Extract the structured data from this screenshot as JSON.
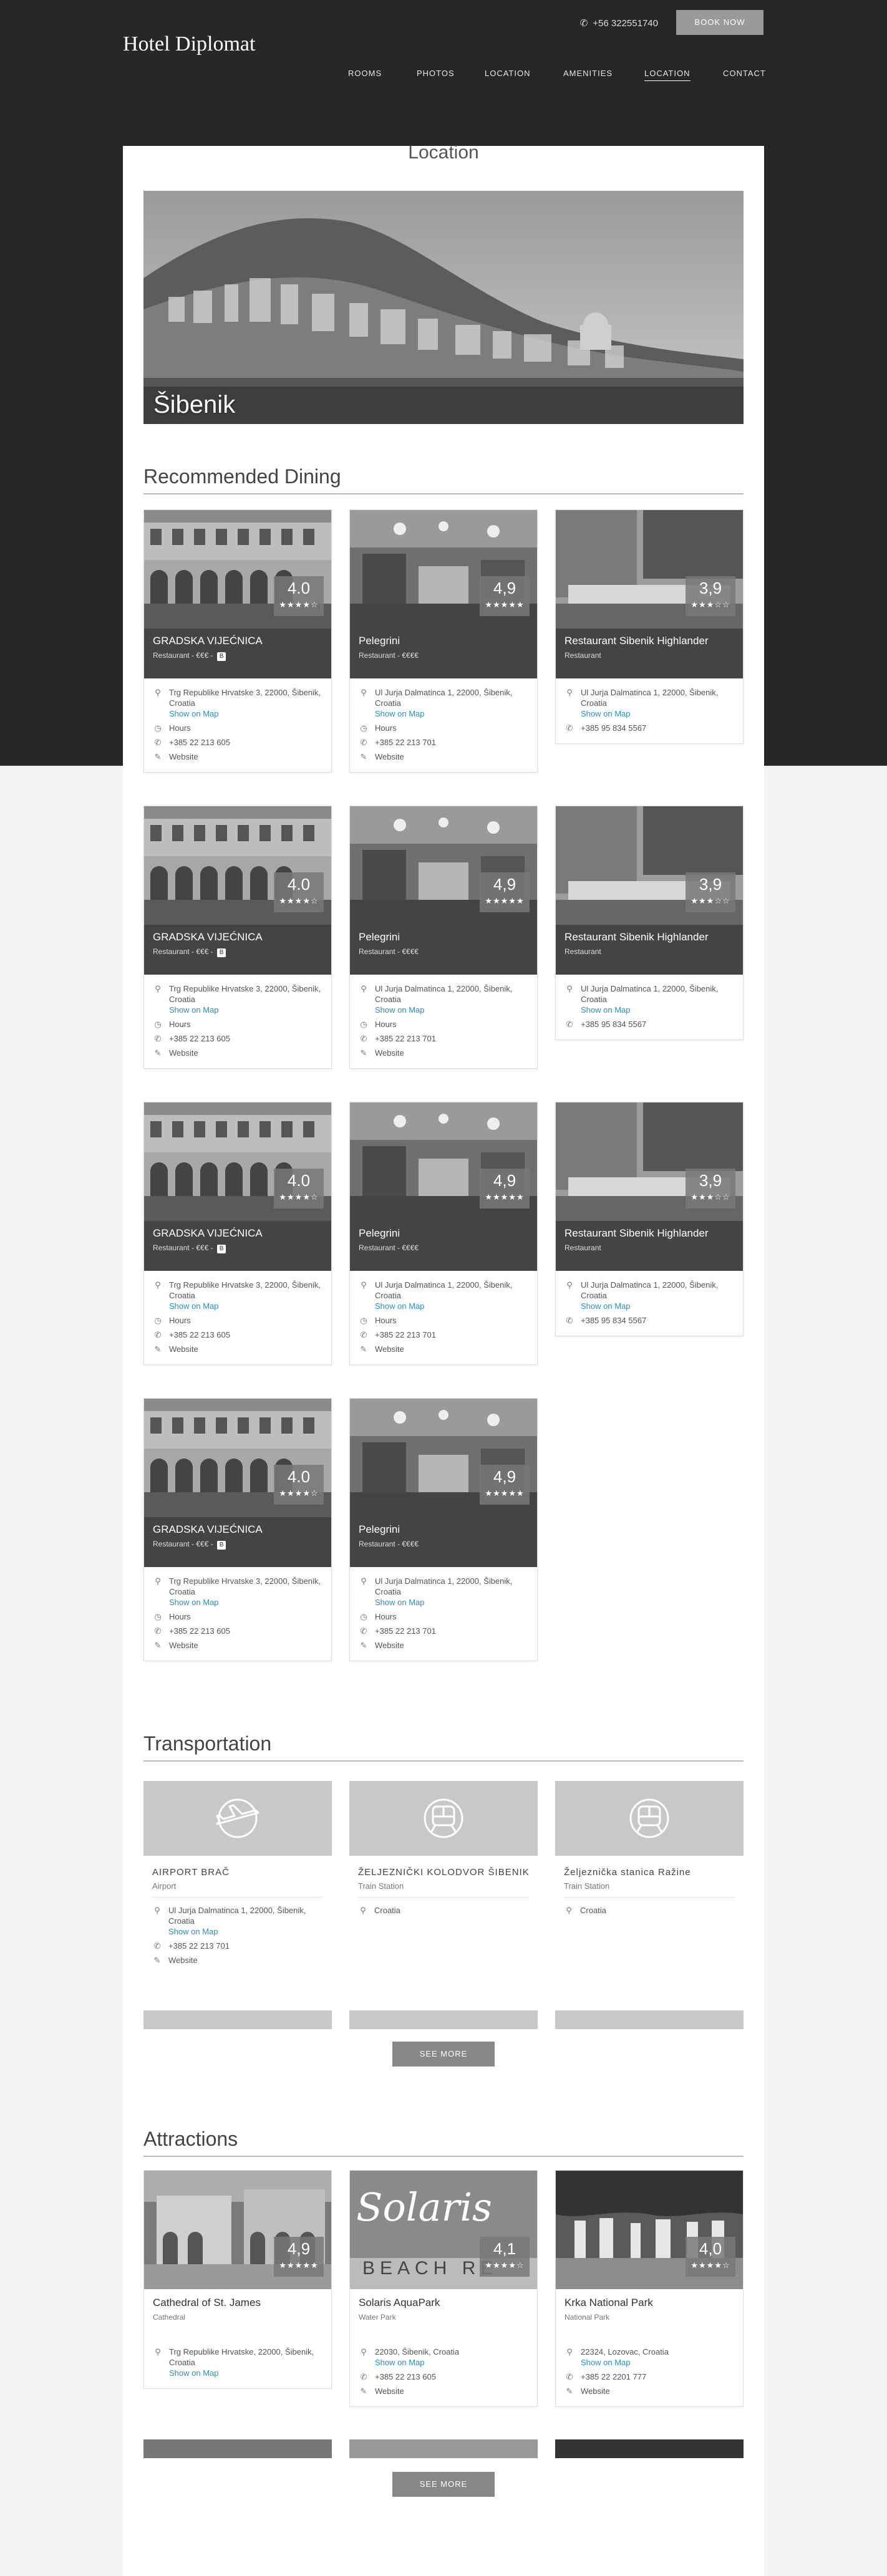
{
  "header": {
    "brand": "Hotel Diplomat",
    "phone": "+56 322551740",
    "book_label": "BOOK NOW",
    "nav": [
      "ROOMS",
      "PHOTOS",
      "LOCATION",
      "AMENITIES",
      "LOCATION",
      "CONTACT"
    ],
    "active_nav": "LOCATION"
  },
  "location": {
    "title": "Location",
    "hero_caption": "Šibenik"
  },
  "dining": {
    "title": "Recommended Dining",
    "cards": [
      {
        "name": "GRADSKA VIJEĆNICA",
        "type": "Restaurant - €€€ -",
        "badge": "B",
        "rating": "4.0",
        "stars": "★★★★☆",
        "address": "Trg Republike Hrvatske 3, 22000, Šibenik, Croatia",
        "show_map": "Show on Map",
        "hours": "Hours",
        "phone": "+385 22 213 605",
        "website": "Website"
      },
      {
        "name": "Pelegrini",
        "type": "Restaurant - €€€€",
        "badge": "",
        "rating": "4,9",
        "stars": "★★★★★",
        "address": "Ul Jurja Dalmatinca 1, 22000, Šibenik, Croatia",
        "show_map": "Show on Map",
        "hours": "Hours",
        "phone": "+385 22 213 701",
        "website": "Website"
      },
      {
        "name": "Restaurant Sibenik Highlander",
        "type": "Restaurant",
        "badge": "",
        "rating": "3,9",
        "stars": "★★★☆☆",
        "address": "Ul Jurja Dalmatinca 1, 22000, Šibenik, Croatia",
        "show_map": "Show on Map",
        "hours": "",
        "phone": "+385 95 834 5567",
        "website": ""
      }
    ]
  },
  "transportation": {
    "title": "Transportation",
    "cards": [
      {
        "name": "AIRPORT BRAČ",
        "type": "Airport",
        "address": "Ul Jurja Dalmatinca 1, 22000, Šibenik, Croatia",
        "show_map": "Show on Map",
        "phone": "+385 22 213 701",
        "website": "Website"
      },
      {
        "name": "ŽELJEZNIČKI KOLODVOR ŠIBENIK",
        "type": "Train Station",
        "address": "Croatia"
      },
      {
        "name": "Željeznička stanica Ražine",
        "type": "Train Station",
        "address": "Croatia"
      }
    ],
    "see_more": "SEE MORE"
  },
  "attractions": {
    "title": "Attractions",
    "cards": [
      {
        "name": "Cathedral of St. James",
        "type": "Cathedral",
        "rating": "4,9",
        "stars": "★★★★★",
        "address": "Trg Republike Hrvatske, 22000, Šibenik, Croatia",
        "show_map": "Show on Map",
        "phone": "",
        "website": ""
      },
      {
        "name": "Solaris AquaPark",
        "type": "Water Park",
        "rating": "4,1",
        "stars": "★★★★☆",
        "sign_top": "Solaris",
        "sign_bottom": "BEACH RE",
        "address": "22030, Šibenik, Croatia",
        "show_map": "Show on Map",
        "phone": "+385 22 213 605",
        "website": "Website"
      },
      {
        "name": "Krka National Park",
        "type": "National Park",
        "rating": "4,0",
        "stars": "★★★★☆",
        "address": "22324, Lozovac, Croatia",
        "show_map": "Show on Map",
        "phone": "+385 22 2201 777",
        "website": "Website"
      }
    ],
    "see_more": "SEE MORE"
  }
}
